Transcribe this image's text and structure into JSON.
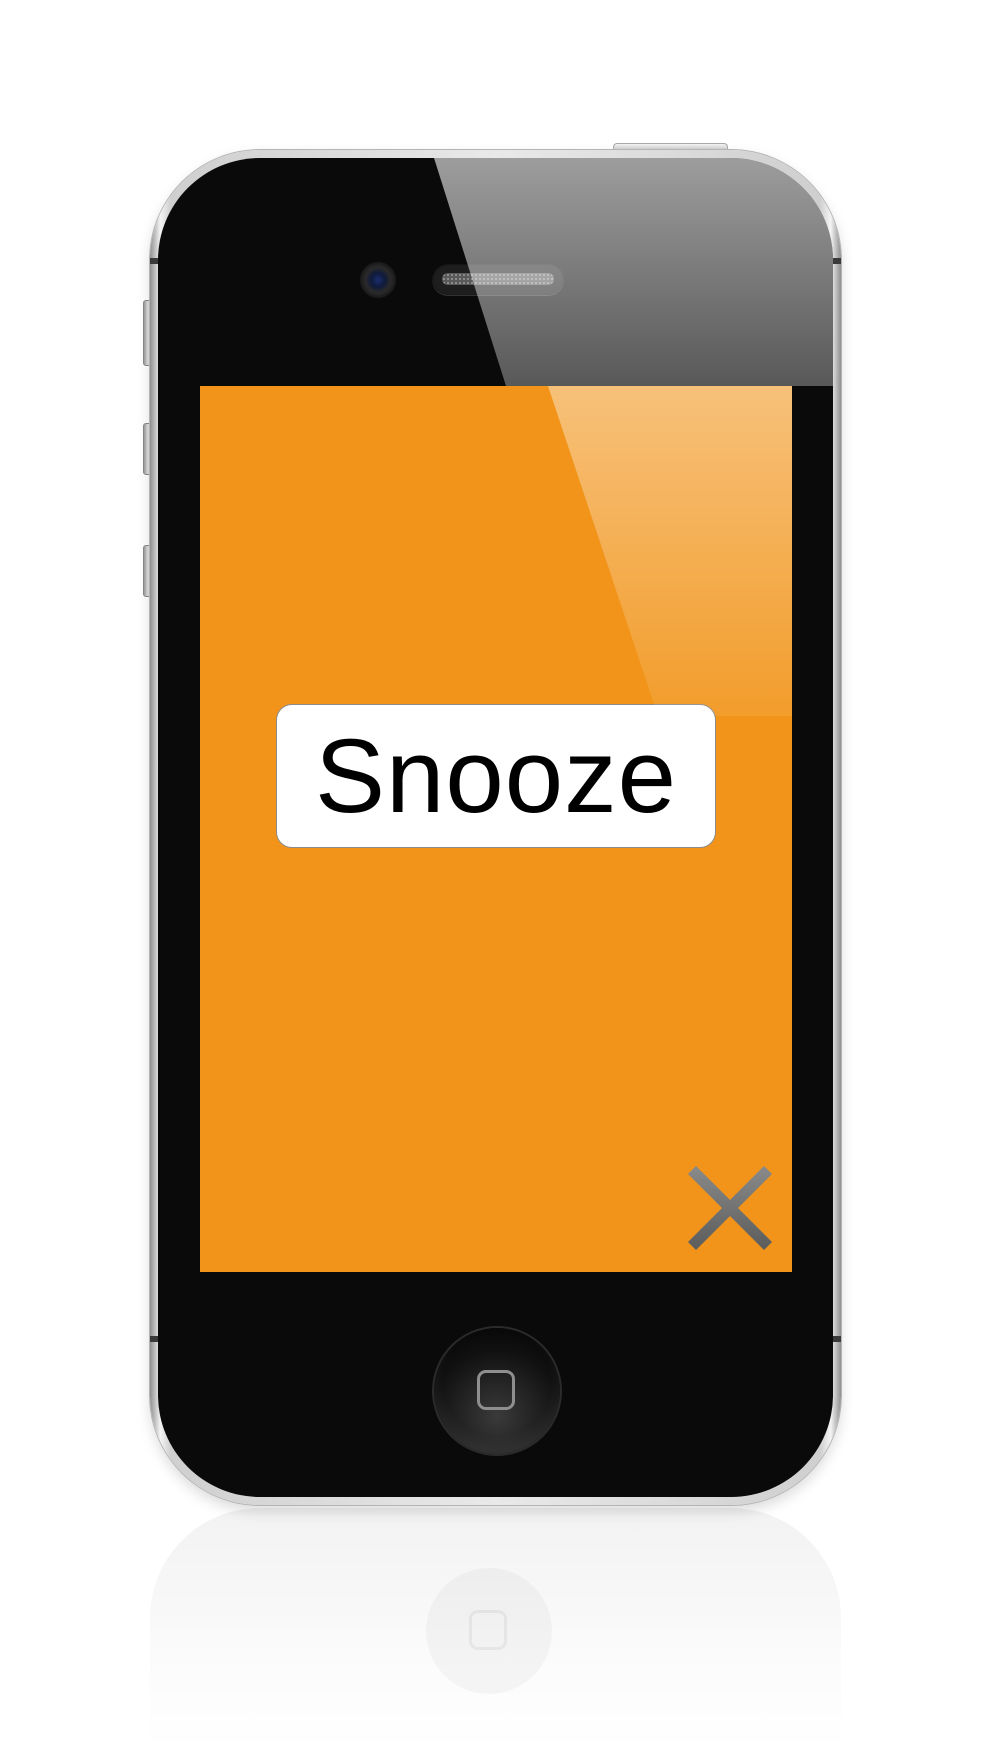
{
  "device": {
    "frame_color": "#0a0a0a",
    "bezel_color": "#d9d9d9"
  },
  "screen": {
    "background_color": "#f19419"
  },
  "snooze_button": {
    "label": "Snooze"
  },
  "close_button": {
    "icon": "close-icon",
    "color": "#6e6e6e"
  },
  "home_button": {
    "icon": "home-square-icon"
  }
}
